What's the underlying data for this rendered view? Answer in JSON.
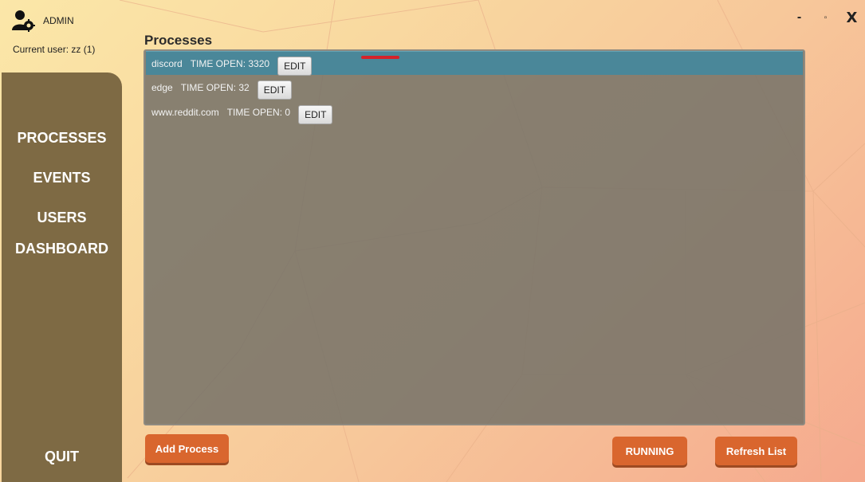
{
  "header": {
    "admin_label": "ADMIN",
    "current_user": "Current user: zz (1)",
    "user_icon": "user-settings-icon"
  },
  "window_controls": {
    "minimize": "-",
    "maximize": "▫",
    "close": "X"
  },
  "sidebar": {
    "items": [
      {
        "label": "PROCESSES"
      },
      {
        "label": "EVENTS"
      },
      {
        "label": "USERS"
      },
      {
        "label": "DASHBOARD"
      }
    ],
    "quit_label": "QUIT"
  },
  "main": {
    "title": "Processes",
    "processes": [
      {
        "name": "discord",
        "time": "TIME OPEN: 3320",
        "edit_label": "EDIT",
        "selected": true
      },
      {
        "name": "edge",
        "time": "TIME OPEN: 32",
        "edit_label": "EDIT",
        "selected": false
      },
      {
        "name": "www.reddit.com",
        "time": "TIME OPEN: 0",
        "edit_label": "EDIT",
        "selected": false
      }
    ]
  },
  "footer": {
    "add_process_label": "Add Process",
    "running_label": "RUNNING",
    "refresh_label": "Refresh List"
  },
  "colors": {
    "sidebar": "#7e6a44",
    "selected_row": "#4a8799",
    "accent_button": "#d9662e",
    "annotation_mark": "#d4232a"
  }
}
